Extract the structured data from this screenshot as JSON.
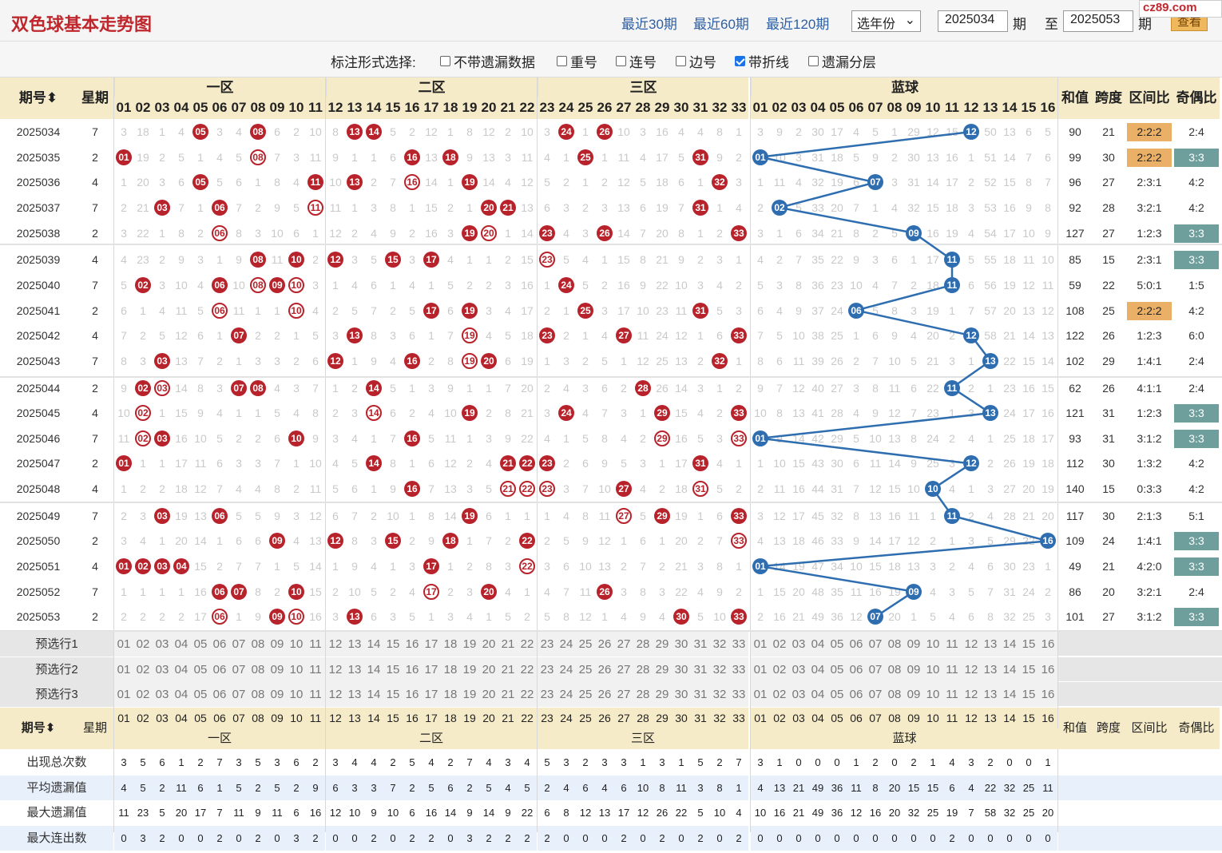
{
  "title": "双色球基本走势图",
  "logo": "cz89.com",
  "nav": {
    "recent30": "最近30期",
    "recent60": "最近60期",
    "recent120": "最近120期",
    "year_select": "选年份",
    "from_issue": "2025034",
    "period1": "期",
    "to": "至",
    "to_issue": "2025053",
    "period2": "期",
    "query": "查看"
  },
  "options": {
    "label": "标注形式选择:",
    "items": [
      {
        "label": "不带遗漏数据",
        "checked": false
      },
      {
        "label": "重号",
        "checked": false
      },
      {
        "label": "连号",
        "checked": false
      },
      {
        "label": "边号",
        "checked": false
      },
      {
        "label": "带折线",
        "checked": true
      },
      {
        "label": "遗漏分层",
        "checked": false
      }
    ]
  },
  "headers": {
    "issue": "期号",
    "week": "星期",
    "zone1": "一区",
    "zone2": "二区",
    "zone3": "三区",
    "blue": "蓝球",
    "sum": "和值",
    "span": "跨度",
    "zone_ratio": "区间比",
    "odd_even": "奇偶比"
  },
  "rows": [
    {
      "issue": "2025034",
      "week": "7",
      "red": [
        5,
        8,
        13,
        14,
        24,
        26
      ],
      "blue": 12,
      "sum": "90",
      "span": "21",
      "zr": "2:2:2",
      "oe": "2:4",
      "zh": 1,
      "oh": 0
    },
    {
      "issue": "2025035",
      "week": "2",
      "red": [
        1,
        8,
        16,
        18,
        25,
        31
      ],
      "blue": 1,
      "sum": "99",
      "span": "30",
      "zr": "2:2:2",
      "oe": "3:3",
      "zh": 1,
      "oh": 1
    },
    {
      "issue": "2025036",
      "week": "4",
      "red": [
        5,
        11,
        13,
        16,
        19,
        32
      ],
      "blue": 7,
      "sum": "96",
      "span": "27",
      "zr": "2:3:1",
      "oe": "4:2",
      "zh": 0,
      "oh": 0
    },
    {
      "issue": "2025037",
      "week": "7",
      "red": [
        3,
        6,
        11,
        20,
        21,
        31
      ],
      "blue": 2,
      "sum": "92",
      "span": "28",
      "zr": "3:2:1",
      "oe": "4:2",
      "zh": 0,
      "oh": 0
    },
    {
      "issue": "2025038",
      "week": "2",
      "red": [
        6,
        19,
        20,
        23,
        26,
        33
      ],
      "blue": 9,
      "sum": "127",
      "span": "27",
      "zr": "1:2:3",
      "oe": "3:3",
      "zh": 0,
      "oh": 1
    },
    {
      "issue": "2025039",
      "week": "4",
      "red": [
        8,
        10,
        12,
        15,
        17,
        23
      ],
      "blue": 11,
      "sum": "85",
      "span": "15",
      "zr": "2:3:1",
      "oe": "3:3",
      "zh": 0,
      "oh": 1
    },
    {
      "issue": "2025040",
      "week": "7",
      "red": [
        2,
        6,
        8,
        9,
        10,
        24
      ],
      "blue": 11,
      "sum": "59",
      "span": "22",
      "zr": "5:0:1",
      "oe": "1:5",
      "zh": 0,
      "oh": 0
    },
    {
      "issue": "2025041",
      "week": "2",
      "red": [
        6,
        10,
        17,
        19,
        25,
        31
      ],
      "blue": 6,
      "sum": "108",
      "span": "25",
      "zr": "2:2:2",
      "oe": "4:2",
      "zh": 1,
      "oh": 0
    },
    {
      "issue": "2025042",
      "week": "4",
      "red": [
        7,
        13,
        19,
        23,
        27,
        33
      ],
      "blue": 12,
      "sum": "122",
      "span": "26",
      "zr": "1:2:3",
      "oe": "6:0",
      "zh": 0,
      "oh": 0
    },
    {
      "issue": "2025043",
      "week": "7",
      "red": [
        3,
        12,
        16,
        19,
        20,
        32
      ],
      "blue": 13,
      "sum": "102",
      "span": "29",
      "zr": "1:4:1",
      "oe": "2:4",
      "zh": 0,
      "oh": 0
    },
    {
      "issue": "2025044",
      "week": "2",
      "red": [
        2,
        3,
        7,
        8,
        14,
        28
      ],
      "blue": 11,
      "sum": "62",
      "span": "26",
      "zr": "4:1:1",
      "oe": "2:4",
      "zh": 0,
      "oh": 0
    },
    {
      "issue": "2025045",
      "week": "4",
      "red": [
        2,
        14,
        19,
        24,
        29,
        33
      ],
      "blue": 13,
      "sum": "121",
      "span": "31",
      "zr": "1:2:3",
      "oe": "3:3",
      "zh": 0,
      "oh": 1
    },
    {
      "issue": "2025046",
      "week": "7",
      "red": [
        2,
        3,
        10,
        16,
        29,
        33
      ],
      "blue": 1,
      "sum": "93",
      "span": "31",
      "zr": "3:1:2",
      "oe": "3:3",
      "zh": 0,
      "oh": 1
    },
    {
      "issue": "2025047",
      "week": "2",
      "red": [
        1,
        14,
        21,
        22,
        23,
        31
      ],
      "blue": 12,
      "sum": "112",
      "span": "30",
      "zr": "1:3:2",
      "oe": "4:2",
      "zh": 0,
      "oh": 0
    },
    {
      "issue": "2025048",
      "week": "4",
      "red": [
        16,
        21,
        22,
        23,
        27,
        31
      ],
      "blue": 10,
      "sum": "140",
      "span": "15",
      "zr": "0:3:3",
      "oe": "4:2",
      "zh": 0,
      "oh": 0
    },
    {
      "issue": "2025049",
      "week": "7",
      "red": [
        3,
        6,
        19,
        27,
        29,
        33
      ],
      "blue": 11,
      "sum": "117",
      "span": "30",
      "zr": "2:1:3",
      "oe": "5:1",
      "zh": 0,
      "oh": 0
    },
    {
      "issue": "2025050",
      "week": "2",
      "red": [
        9,
        12,
        15,
        18,
        22,
        33
      ],
      "blue": 16,
      "sum": "109",
      "span": "24",
      "zr": "1:4:1",
      "oe": "3:3",
      "zh": 0,
      "oh": 1
    },
    {
      "issue": "2025051",
      "week": "4",
      "red": [
        1,
        2,
        3,
        4,
        17,
        22
      ],
      "blue": 1,
      "sum": "49",
      "span": "21",
      "zr": "4:2:0",
      "oe": "3:3",
      "zh": 0,
      "oh": 1
    },
    {
      "issue": "2025052",
      "week": "7",
      "red": [
        6,
        7,
        10,
        17,
        20,
        26
      ],
      "blue": 9,
      "sum": "86",
      "span": "20",
      "zr": "3:2:1",
      "oe": "2:4",
      "zh": 0,
      "oh": 0
    },
    {
      "issue": "2025053",
      "week": "2",
      "red": [
        6,
        9,
        10,
        13,
        30,
        33
      ],
      "blue": 7,
      "sum": "101",
      "span": "27",
      "zr": "3:1:2",
      "oe": "3:3",
      "zh": 0,
      "oh": 1
    }
  ],
  "miss_rows": [
    [
      "3 18 1 4 _ 3 4 _ 6 2 10 8 _ _ 5 2 12 1 8 12 2 10 3 _ 1 _ 10 3 16 4 4 8 1",
      "3 9 2 30 17 4 5 1 29 12 15 _ 50 13 6 5"
    ],
    [
      "_ 19 2 5 1 4 5 _ 7 3 11 9 1 1 6 _ 13 _ 9 13 3 11 4 1 _ 1 11 4 17 5 _ 9 2",
      "_ 10 3 31 18 5 9 2 30 13 16 1 51 14 7 6"
    ],
    [
      "1 20 3 6 _ 5 6 1 8 4 _ 10 _ 2 7 _ 14 1 _ 14 4 12 5 2 1 2 12 5 18 6 1 _ 3",
      "1 11 4 32 19 6 _ 3 31 14 17 2 52 15 8 7"
    ],
    [
      "2 21 _ 7 1 _ 7 2 9 5 _ 11 1 3 8 1 15 2 1 _ _ 13 6 3 2 3 13 6 19 7 _ 1 4",
      "2 _ 5 33 20 7 1 4 32 15 18 3 53 16 9 8"
    ],
    [
      "3 22 1 8 2 _ 8 3 10 6 1 12 2 4 9 2 16 3 _ _ 1 14 _ 4 3 _ 14 7 20 8 1 2 _",
      "3 1 6 34 21 8 2 5 _ 16 19 4 54 17 10 9"
    ],
    [
      "4 23 2 9 3 1 9 _ 11 _ 2 _ 3 5 _ 3 _ 4 1 1 2 15 _ 5 4 1 15 8 21 9 2 3 1",
      "4 2 7 35 22 9 3 6 1 17 _ 5 55 18 11 10"
    ],
    [
      "5 _ 3 10 4 _ 10 _ _ _ 3 1 4 6 1 4 1 5 2 2 3 16 1 _ 5 2 16 9 22 10 3 4 2",
      "5 3 8 36 23 10 4 7 2 18 _ 6 56 19 12 11"
    ],
    [
      "6 1 4 11 5 _ 11 1 1 _ 4 2 5 7 2 5 _ 6 _ 3 4 17 2 1 _ 3 17 10 23 11 _ 5 3",
      "6 4 9 37 24 _ 5 8 3 19 1 7 57 20 13 12"
    ],
    [
      "7 2 5 12 6 1 _ 2 2 1 5 3 _ 8 3 6 1 7 _ 4 5 18 _ 2 1 4 _ 11 24 12 1 6 _",
      "7 5 10 38 25 1 6 9 4 20 2 _ 58 21 14 13"
    ],
    [
      "8 3 _ 13 7 2 1 3 3 2 6 _ 1 9 4 _ 2 8 _ _ 6 19 1 3 2 5 1 12 25 13 2 _ 1",
      "8 6 11 39 26 2 7 10 5 21 3 1 _ 22 15 14"
    ],
    [
      "9 _ _ 14 8 3 _ _ 4 3 7 1 2 _ 5 1 3 9 1 1 7 20 2 4 3 6 2 _ 26 14 3 1 2",
      "9 7 12 40 27 3 8 11 6 22 _ 2 1 23 16 15"
    ],
    [
      "10 _ 1 15 9 4 1 1 5 4 8 2 3 _ 6 2 4 10 _ 2 8 21 3 _ 4 7 3 1 _ 15 4 2 _",
      "10 8 13 41 28 4 9 12 7 23 1 3 _ 24 17 16"
    ],
    [
      "11 _ _ 16 10 5 2 2 6 _ 9 3 4 1 7 _ 5 11 1 3 9 22 4 1 5 8 4 2 _ 16 5 3 _",
      "_ 9 14 42 29 5 10 13 8 24 2 4 1 25 18 17"
    ],
    [
      "_ 1 1 17 11 6 3 3 7 1 10 4 5 _ 8 1 6 12 2 4 _ _ _ 2 6 9 5 3 1 17 _ 4 1",
      "1 10 15 43 30 6 11 14 9 25 3 _ 2 26 19 18"
    ],
    [
      "1 2 2 18 12 7 4 4 8 2 11 5 6 1 9 _ 7 13 3 5 _ _ _ 3 7 10 _ 4 2 18 _ 5 2",
      "2 11 16 44 31 7 12 15 10 _ 4 1 3 27 20 19"
    ],
    [
      "2 3 _ 19 13 _ 5 5 9 3 12 6 7 2 10 1 8 14 _ 6 1 1 1 4 8 11 _ 5 _ 19 1 6 _",
      "3 12 17 45 32 8 13 16 11 1 _ 2 4 28 21 20"
    ],
    [
      "3 4 1 20 14 1 6 6 _ 4 13 _ 8 3 _ 2 9 _ 1 7 2 _ 2 5 9 12 1 6 1 20 2 7 _",
      "4 13 18 46 33 9 14 17 12 2 1 3 5 29 22 _"
    ],
    [
      "_ _ _ _ 15 2 7 7 1 5 14 1 9 4 1 3 _ 1 2 8 3 _ 3 6 10 13 2 7 2 21 3 8 1",
      "_ 14 19 47 34 10 15 18 13 3 2 4 6 30 23 1"
    ],
    [
      "1 1 1 1 16 _ _ 8 2 _ 15 2 10 5 2 4 _ 2 3 _ 4 1 4 7 11 _ 3 8 3 22 4 9 2",
      "1 15 20 48 35 11 16 19 _ 4 3 5 7 31 24 2"
    ],
    [
      "2 2 2 2 17 _ 1 9 _ _ 16 3 _ 6 3 5 1 3 4 1 5 2 5 8 12 1 4 9 4 _ 5 10 _",
      "2 16 21 49 36 12 _ 20 1 5 4 6 8 32 25 3"
    ]
  ],
  "preselect": [
    "预选行1",
    "预选行2",
    "预选行3"
  ],
  "footer": {
    "issue": "期号",
    "week": "星期",
    "sum": "和值",
    "span": "跨度",
    "zone_ratio": "区间比",
    "odd_even": "奇偶比"
  },
  "stats": [
    {
      "label": "出现总次数",
      "red": "3 5 6 1 2 7 3 5 3 6 2 3 4 4 2 5 4 2 7 4 3 4 5 3 2 3 3 1 3 1 5 2 7",
      "blue": "3 1 0 0 0 1 2 0 2 1 4 3 2 0 0 1"
    },
    {
      "label": "平均遗漏值",
      "red": "4 5 2 11 6 1 5 2 5 2 9 6 3 3 7 2 5 6 2 5 4 5 2 4 6 4 6 10 8 11 3 8 1",
      "blue": "4 13 21 49 36 11 8 20 15 15 6 4 22 32 25 11"
    },
    {
      "label": "最大遗漏值",
      "red": "11 23 5 20 17 7 11 9 11 6 16 12 10 9 10 6 16 14 9 14 9 22 6 8 12 13 17 12 26 22 5 10 4",
      "blue": "10 16 21 49 36 12 16 20 32 25 19 7 58 32 25 20"
    },
    {
      "label": "最大连出数",
      "red": "0 3 2 0 0 2 0 2 0 3 2 0 0 2 0 2 2 0 3 2 2 2 2 0 0 0 2 0 2 0 2 0 2",
      "blue": "0 0 0 0 0 0 0 0 0 0 2 0 0 0 0 0"
    }
  ],
  "colors": {
    "red_ball": "#b8222a",
    "blue_ball": "#2e6eb0",
    "header_bg": "#f6ebc8",
    "orange": "#eab067",
    "teal": "#6f9f9d"
  }
}
